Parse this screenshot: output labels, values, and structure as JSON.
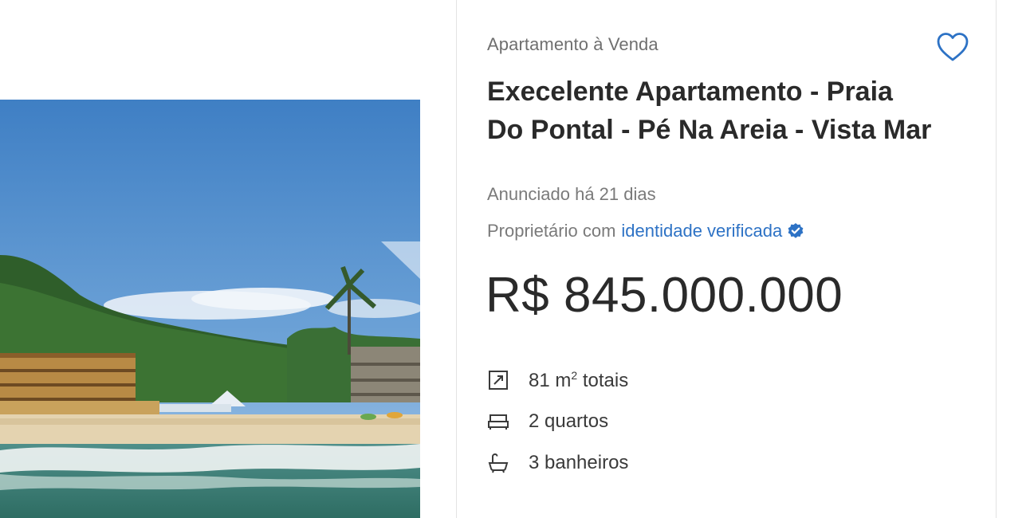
{
  "listing": {
    "category": "Apartamento à Venda",
    "title": "Execelente Apartamento - Praia Do Pontal - Pé Na Areia - Vista Mar",
    "posted": "Anunciado há 21 dias",
    "owner_prefix": "Proprietário com",
    "owner_verified_link": "identidade verificada",
    "price": "R$ 845.000.000",
    "favorite_icon": "heart-outline-icon",
    "verified_icon": "verified-badge-icon",
    "accent_color": "#2d72c5"
  },
  "features": {
    "area_value": "81 m",
    "area_unit_sup": "2",
    "area_suffix": " totais",
    "area_icon": "expand-area-icon",
    "bedrooms": "2 quartos",
    "bedrooms_icon": "bed-icon",
    "bathrooms": "3 banheiros",
    "bathrooms_icon": "bathtub-icon"
  }
}
